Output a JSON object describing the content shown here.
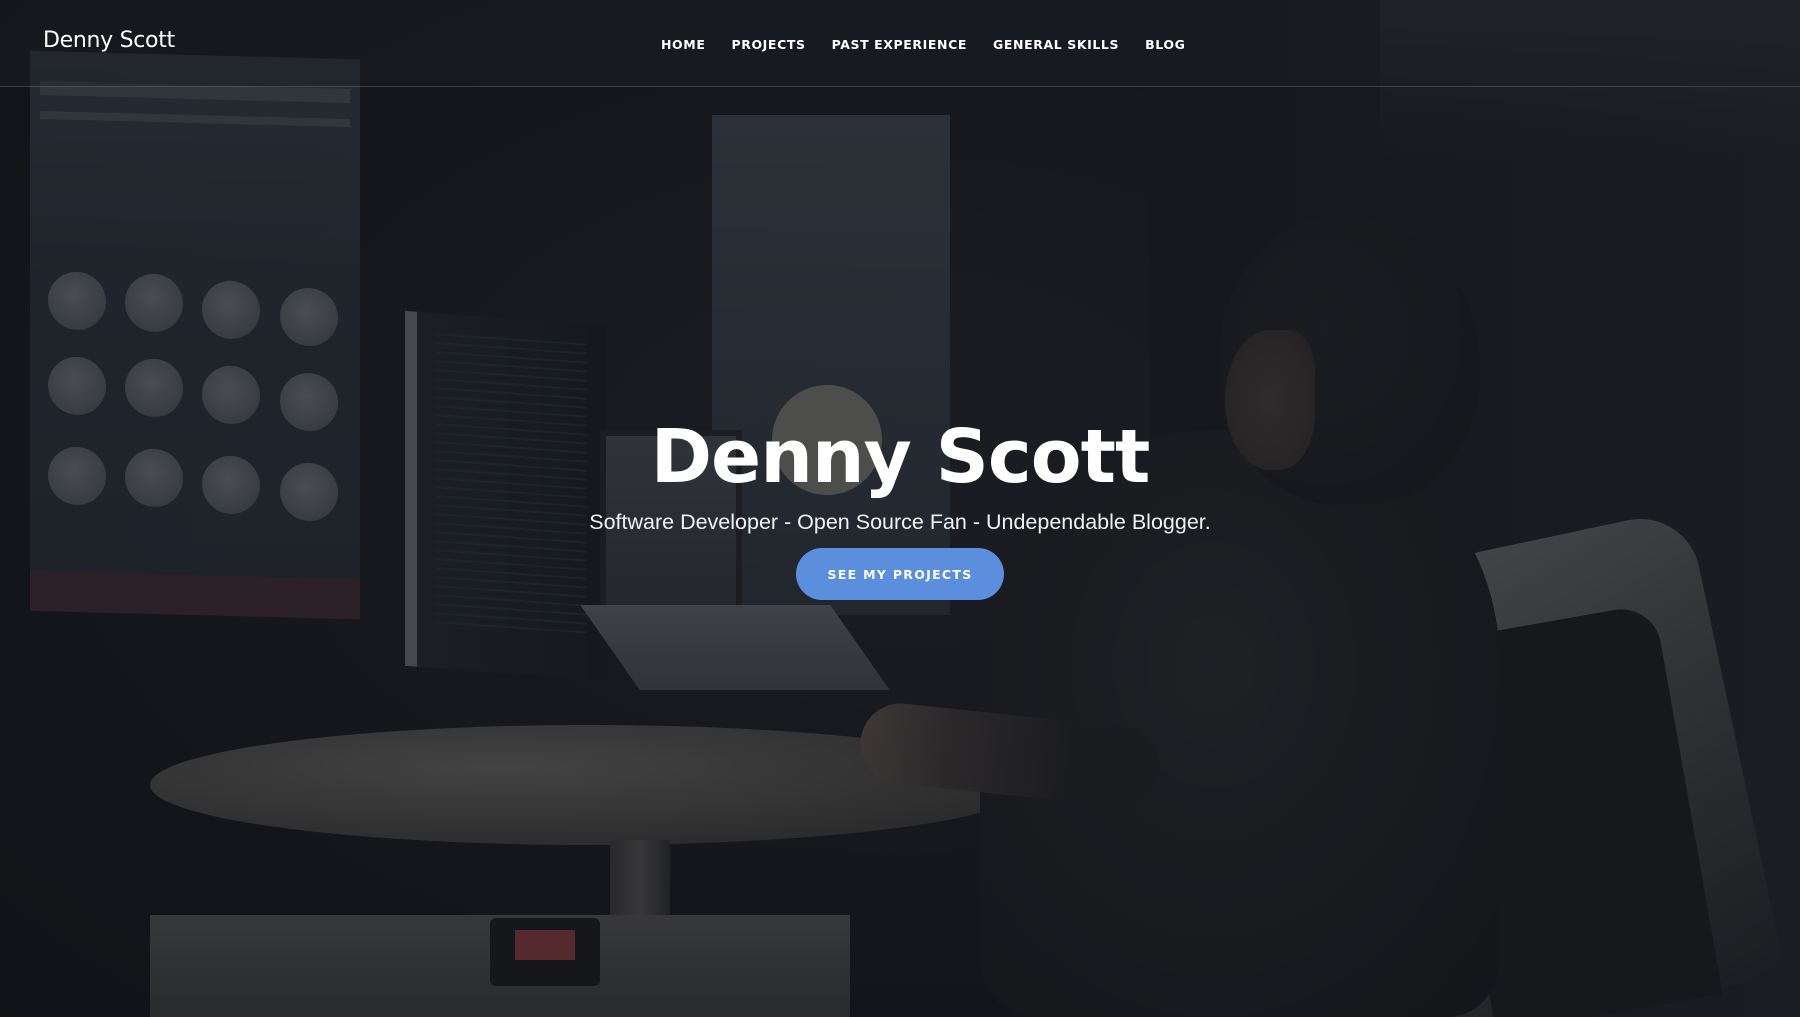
{
  "nav": {
    "brand": "Denny Scott",
    "items": [
      {
        "label": "HOME"
      },
      {
        "label": "PROJECTS"
      },
      {
        "label": "PAST EXPERIENCE"
      },
      {
        "label": "GENERAL SKILLS"
      },
      {
        "label": "BLOG"
      }
    ]
  },
  "hero": {
    "title": "Denny Scott",
    "subtitle": "Software Developer - Open Source Fan - Undependable Blogger.",
    "cta_label": "SEE MY PROJECTS",
    "background": "video-background"
  },
  "colors": {
    "accent": "#5b8fdd",
    "overlay": "#121318",
    "text": "#ffffff"
  }
}
